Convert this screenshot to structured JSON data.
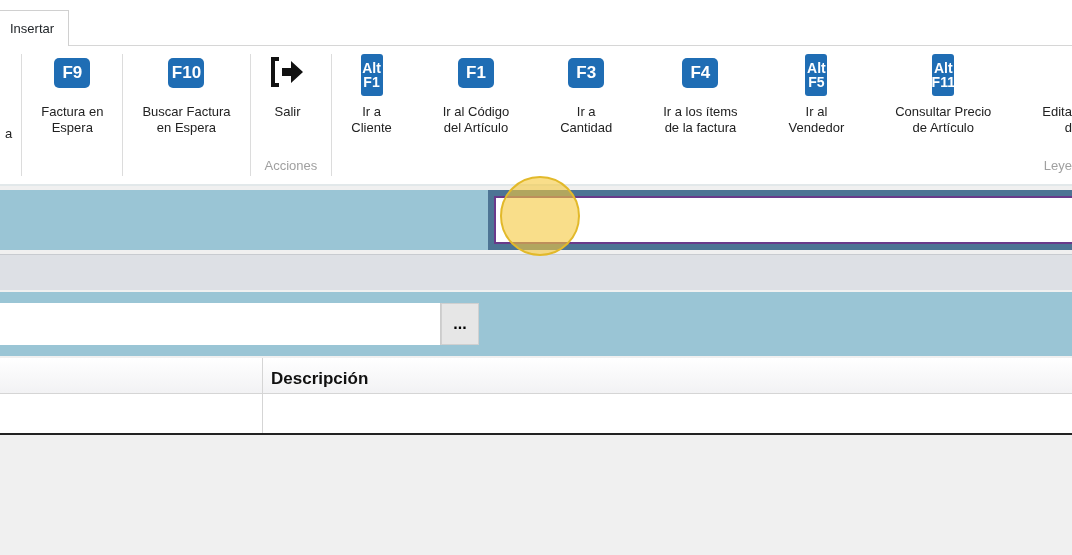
{
  "tabs": [
    {
      "label": "Insertar",
      "selected": true
    }
  ],
  "ribbon": {
    "groups": [
      {
        "items": [
          {
            "kind": "partial",
            "lines": [
              "a"
            ]
          }
        ]
      },
      {
        "items": [
          {
            "kind": "key",
            "key_lines": [
              "F9"
            ],
            "lines": [
              "Factura en",
              "Espera"
            ]
          }
        ]
      },
      {
        "items": [
          {
            "kind": "key",
            "key_lines": [
              "F10"
            ],
            "lines": [
              "Buscar Factura",
              "en Espera"
            ]
          }
        ]
      },
      {
        "label": "Acciones",
        "items": [
          {
            "kind": "exit",
            "lines": [
              "Salir"
            ]
          }
        ]
      },
      {
        "label": "Leye",
        "items": [
          {
            "kind": "alt",
            "key_lines": [
              "Alt",
              "F1"
            ],
            "lines": [
              "Ir a",
              "Cliente"
            ]
          },
          {
            "kind": "key",
            "key_lines": [
              "F1"
            ],
            "lines": [
              "Ir al Código",
              "del Artículo"
            ]
          },
          {
            "kind": "key",
            "key_lines": [
              "F3"
            ],
            "lines": [
              "Ir a",
              "Cantidad"
            ]
          },
          {
            "kind": "key",
            "key_lines": [
              "F4"
            ],
            "lines": [
              "Ir a los ítems",
              "de la factura"
            ]
          },
          {
            "kind": "alt",
            "key_lines": [
              "Alt",
              "F5"
            ],
            "lines": [
              "Ir al",
              "Vendedor"
            ]
          },
          {
            "kind": "alt",
            "key_lines": [
              "Alt",
              "F11"
            ],
            "lines": [
              "Consultar Precio",
              "de Artículo"
            ]
          },
          {
            "kind": "cut",
            "lines": [
              "Edita",
              "d"
            ]
          }
        ]
      }
    ]
  },
  "search_bar": {
    "focused": true
  },
  "article_bar": {
    "browse_button": "..."
  },
  "table": {
    "columns": [
      {
        "label": "Descripción"
      }
    ]
  },
  "click_highlight": {
    "visible": true
  }
}
